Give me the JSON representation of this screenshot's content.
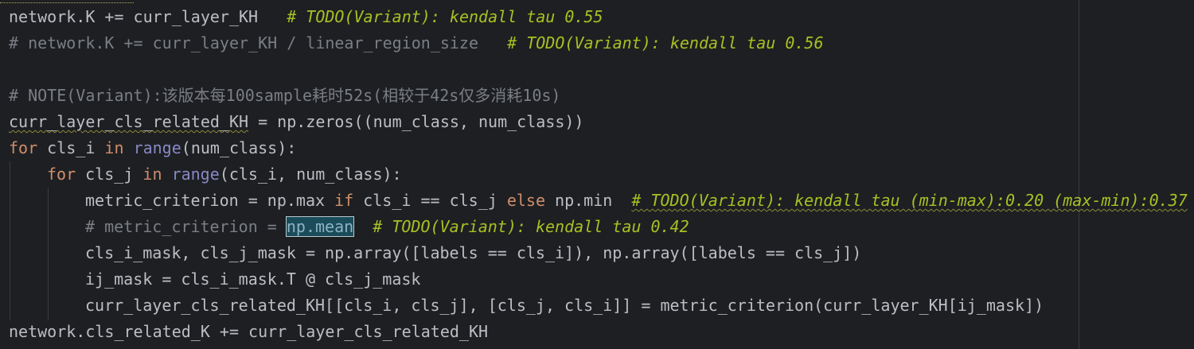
{
  "code": {
    "l1": {
      "code": "network.K += curr_layer_KH   ",
      "todo": "# TODO(Variant): kendall tau 0.55"
    },
    "l2": {
      "comment": "# network.K += curr_layer_KH / linear_region_size   ",
      "todo": "# TODO(Variant): kendall tau 0.56"
    },
    "l4": {
      "comment": "# NOTE(Variant):该版本每100sample耗时52s(相较于42s仅多消耗10s)"
    },
    "l5": {
      "var": "curr_layer_cls_related_KH",
      "rest": " = np.zeros((num_class, num_class))"
    },
    "l6": {
      "kw_for": "for",
      "mid1": " cls_i ",
      "kw_in": "in",
      "sp": " ",
      "builtin": "range",
      "rest": "(num_class):"
    },
    "l7": {
      "kw_for": "for",
      "mid1": " cls_j ",
      "kw_in": "in",
      "sp": " ",
      "builtin": "range",
      "rest": "(cls_i, num_class):"
    },
    "l8": {
      "a": "metric_criterion = np.max ",
      "kw_if": "if",
      "b": " cls_i == cls_j ",
      "kw_else": "else",
      "c": " np.min  ",
      "todo": "# TODO(Variant): kendall tau (min-max):0.20 (max-min):0.37"
    },
    "l9": {
      "comment": "# metric_criterion = ",
      "highlight": "np.mean",
      "sp": "  ",
      "todo": "# TODO(Variant): kendall tau 0.42"
    },
    "l10": {
      "code": "cls_i_mask, cls_j_mask = np.array([labels == cls_i]), np.array([labels == cls_j])"
    },
    "l11": {
      "code": "ij_mask = cls_i_mask.T @ cls_j_mask"
    },
    "l12": {
      "code": "curr_layer_cls_related_KH[[cls_i, cls_j], [cls_j, cls_i]] = metric_criterion(curr_layer_KH[ij_mask])"
    },
    "l13": {
      "code": "network.cls_related_K += curr_layer_cls_related_KH"
    }
  },
  "colors": {
    "background": "#1e1f22",
    "text": "#bcbec4",
    "keyword": "#cf8e6d",
    "builtin": "#8888c6",
    "comment": "#7a7e85",
    "todo": "#a8c023"
  }
}
